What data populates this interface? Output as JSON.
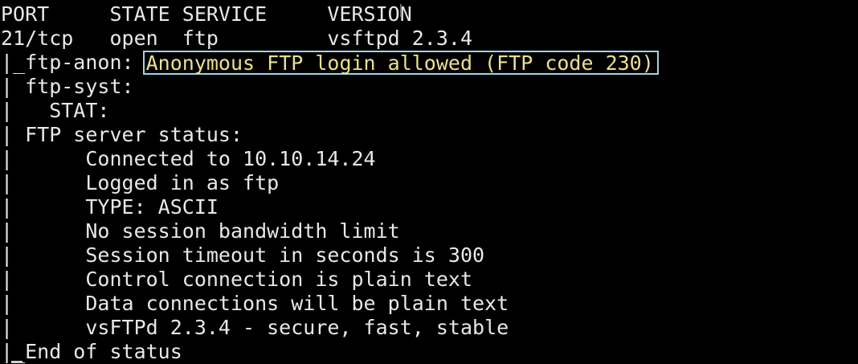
{
  "terminal": {
    "header_line": "PORT     STATE SERVICE     VERSION",
    "port_line": "21/tcp   open  ftp         vsftpd 2.3.4",
    "anon_prefix": "|_ftp-anon: ",
    "anon_result": "Anonymous FTP login allowed (FTP code 230)",
    "lines": [
      "| ftp-syst:",
      "|   STAT:",
      "| FTP server status:",
      "|      Connected to 10.10.14.24",
      "|      Logged in as ftp",
      "|      TYPE: ASCII",
      "|      No session bandwidth limit",
      "|      Session timeout in seconds is 300",
      "|      Control connection is plain text",
      "|      Data connections will be plain text",
      "|      vsFTPd 2.3.4 - secure, fast, stable",
      "|_End of status"
    ],
    "colors": {
      "background": "#000000",
      "text": "#e8e8e8",
      "highlight_text": "#ebe08c",
      "highlight_border": "#9fd4e6"
    }
  }
}
